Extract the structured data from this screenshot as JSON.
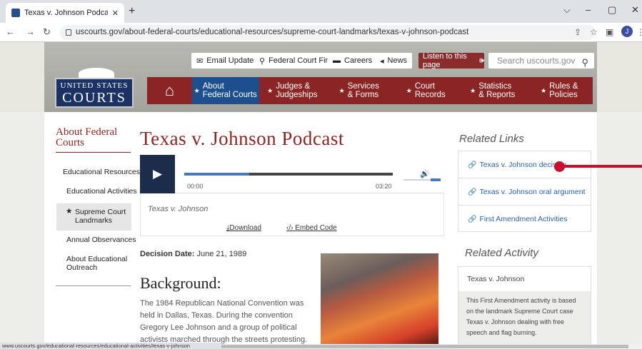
{
  "browser": {
    "tab_title": "Texas v. Johnson Podcast | United",
    "tab_close": "✕",
    "new_tab": "+",
    "url": "uscourts.gov/about-federal-courts/educational-resources/supreme-court-landmarks/texas-v-johnson-podcast",
    "avatar": "J",
    "status_url": "www.uscourts.gov/educational-resources/educational-activities/texas-v-johnson"
  },
  "utility": {
    "email": "Email Updates",
    "finder": "Federal Court Finder",
    "careers": "Careers",
    "news": "News",
    "listen": "Listen to this page",
    "search_placeholder": "Search uscourts.gov"
  },
  "logo": {
    "line1": "UNITED STATES",
    "line2": "COURTS"
  },
  "nav": [
    {
      "label": "About\nFederal Courts"
    },
    {
      "label": "Judges &\nJudgeships"
    },
    {
      "label": "Services\n& Forms"
    },
    {
      "label": "Court\nRecords"
    },
    {
      "label": "Statistics\n& Reports"
    },
    {
      "label": "Rules &\nPolicies"
    }
  ],
  "sidebar": {
    "title": "About Federal Courts",
    "items": [
      "Educational Resources",
      "Educational Activities",
      "Supreme Court Landmarks",
      "Annual Observances",
      "About Educational Outreach"
    ]
  },
  "page": {
    "title": "Texas v. Johnson Podcast",
    "player": {
      "current": "00:00",
      "duration": "03:20",
      "progress": 0.31,
      "caption": "Texas v. Johnson",
      "download": "Download",
      "embed": "Embed Code"
    },
    "decision_label": "Decision Date:",
    "decision_value": "June 21, 1989",
    "background_heading": "Background:",
    "background_text": "The 1984 Republican National Convention was held in Dallas, Texas. During the convention Gregory Lee Johnson and a group of political activists marched through the streets protesting."
  },
  "related_links": {
    "title": "Related Links",
    "items": [
      "Texas v. Johnson decision",
      "Texas v. Johnson oral argument",
      "First Amendment Activities"
    ]
  },
  "related_activity": {
    "title": "Related Activity",
    "head": "Texas v. Johnson",
    "desc": "This First Amendment activity is based on the landmark Supreme Court case Texas v. Johnson dealing with free speech and flag burning."
  },
  "colors": {
    "brand_red": "#8b2424",
    "navy": "#1c2d4c",
    "link_blue": "#2a5fa8",
    "active_nav": "#1d4f8f",
    "pointer": "#c8102e"
  }
}
